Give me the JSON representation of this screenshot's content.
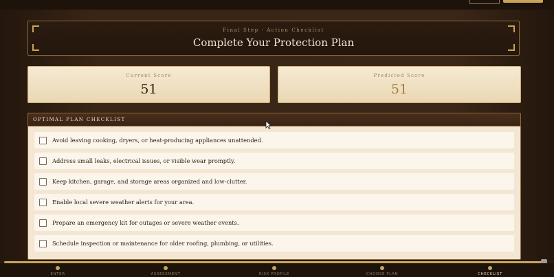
{
  "header": {
    "eyebrow": "Final Step · Action Checklist",
    "title": "Complete Your Protection Plan"
  },
  "scores": {
    "current": {
      "label": "Current Score",
      "value": "51"
    },
    "predicted": {
      "label": "Predicted Score",
      "value": "51"
    }
  },
  "checklist": {
    "title": "OPTIMAL PLAN CHECKLIST",
    "items": [
      {
        "text": "Avoid leaving cooking, dryers, or heat-producing appliances unattended.",
        "checked": false
      },
      {
        "text": "Address small leaks, electrical issues, or visible wear promptly.",
        "checked": false
      },
      {
        "text": "Keep kitchen, garage, and storage areas organized and low-clutter.",
        "checked": false
      },
      {
        "text": "Enable local severe weather alerts for your area.",
        "checked": false
      },
      {
        "text": "Prepare an emergency kit for outages or severe weather events.",
        "checked": false
      },
      {
        "text": "Schedule inspection or maintenance for older roofing, plumbing, or utilities.",
        "checked": false
      }
    ]
  },
  "stepper": {
    "steps": [
      {
        "label": "ENTER"
      },
      {
        "label": "ASSESSMENT"
      },
      {
        "label": "RISK PROFILE"
      },
      {
        "label": "CHOOSE PLAN"
      },
      {
        "label": "CHECKLIST"
      }
    ],
    "active_step": "CHECKLIST"
  },
  "colors": {
    "accent_gold": "#c9a45a",
    "background_dark": "#2a1a10",
    "card_cream": "#f6ead3"
  }
}
